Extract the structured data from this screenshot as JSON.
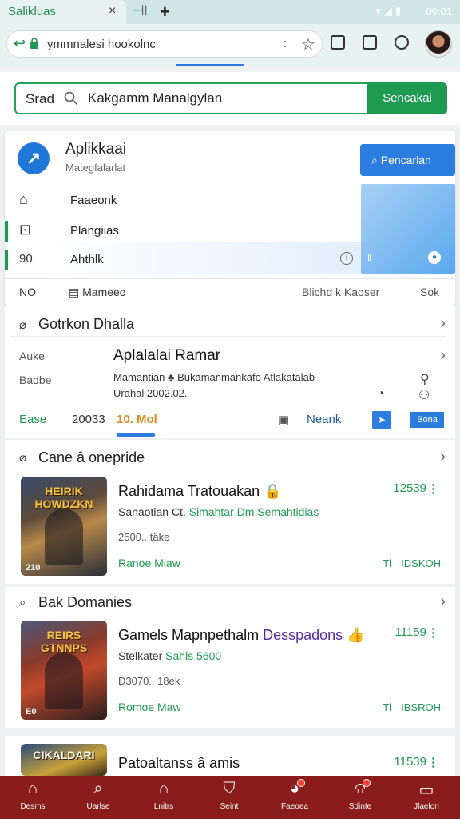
{
  "browser": {
    "tab_title": "Salikluas",
    "tab_close": "×",
    "tab_new_glyph": "+",
    "status_time": "09:01",
    "url": "ymmnalesi hookolnc",
    "url_menu": ":"
  },
  "search": {
    "prefix": "Srad",
    "value": "Kakgamm Manalgylan",
    "button": "Sencakai"
  },
  "app": {
    "title": "Aplikkaai",
    "subtitle": "Mategfalarlat",
    "search_button": "Pencarlan",
    "nav": [
      {
        "label": "Faaeonk"
      },
      {
        "label": "Plangiias"
      },
      {
        "label": "Ahthlk",
        "prefix": "90"
      }
    ],
    "footer": {
      "no": "NO",
      "menu": "Mameeo",
      "kaoser": "Blichd k Kaoser",
      "sok": "Sok"
    }
  },
  "game_detail": {
    "heading": "Gotrkon Dhalla",
    "label_auke": "Auke",
    "label_badbe": "Badbe",
    "title": "Aplalalai Ramar",
    "desc": "Mamantian ♣ Bukamanmankafo Atlakatalab",
    "date": "Urahal 2002.02.",
    "tab_ease": "Ease",
    "tab_year": "20033",
    "tab_active": "10. Mol",
    "tab_neank": "Neank",
    "tag": "Bona"
  },
  "section2": {
    "heading": "Cane â onepride"
  },
  "section3": {
    "heading": "Bak Domanies"
  },
  "games": [
    {
      "cover_text": "HEIRIK HOWDZKN",
      "cover_tag": "210",
      "title": "Rahidama Tratouakan",
      "title_badge": "🔒",
      "sub_prefix": "Sanaotian Ct.",
      "sub_accent": "Simahtar Dm Semahtidias",
      "date": "2500.. täke",
      "store": "Ranoe Miaw",
      "score": "12539",
      "ii": "Tl",
      "size": "IDSKOH"
    },
    {
      "cover_text": "REIRS GTNNPS",
      "cover_tag": "E0",
      "title": "Gamels Mapnpethalm",
      "title_accent": "Desspadons",
      "title_badge": "👍",
      "sub_prefix": "Stelkater",
      "sub_accent": "Sahls 5600",
      "date": "D3070.. 18ek",
      "store": "Romoe Maw",
      "score": "11159",
      "ii": "Tl",
      "size": "IBSROH"
    },
    {
      "cover_text": "CIKALDARI",
      "title": "Patoaltanss â amis",
      "score": "11539"
    }
  ],
  "bottom_nav": [
    {
      "label": "Desms",
      "icon": "home-icon"
    },
    {
      "label": "Uarlse",
      "icon": "search-icon"
    },
    {
      "label": "Lnitrs",
      "icon": "store-icon"
    },
    {
      "label": "Seint",
      "icon": "shield-icon"
    },
    {
      "label": "Faeoea",
      "icon": "chat-icon"
    },
    {
      "label": "Sdinte",
      "icon": "bell-icon"
    },
    {
      "label": "Jlaelon",
      "icon": "menu-icon"
    }
  ],
  "colors": {
    "accent": "#1e9a52",
    "primary": "#2b7de0",
    "bottom_nav": "#8a1c1c"
  }
}
